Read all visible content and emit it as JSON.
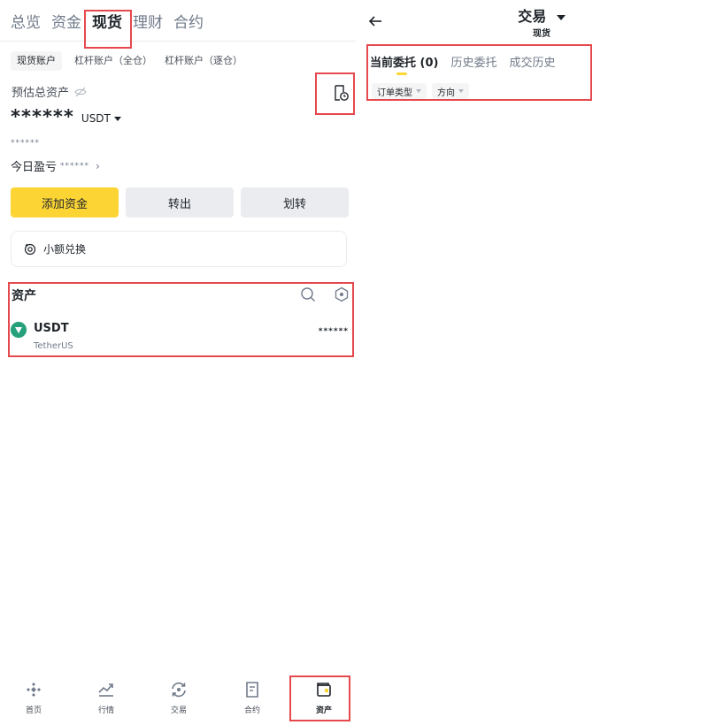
{
  "left": {
    "top_tabs": [
      "总览",
      "资金",
      "现货",
      "理财",
      "合约"
    ],
    "active_top_tab": "现货",
    "sub_tabs": [
      "现货账户",
      "杠杆账户（全仓）",
      "杠杆账户（逐仓）"
    ],
    "est_label": "预估总资产",
    "balance_masked": "******",
    "currency": "USDT",
    "fiat_masked": "******",
    "pnl_label": "今日盈亏",
    "pnl_masked": "******",
    "actions": {
      "add": "添加资金",
      "transfer_out": "转出",
      "transfer": "划转"
    },
    "small_convert": "小额兑换",
    "assets": {
      "title": "资产",
      "rows": [
        {
          "symbol": "USDT",
          "name": "TetherUS",
          "balance": "******"
        }
      ]
    },
    "bottom_nav": [
      "首页",
      "行情",
      "交易",
      "合约",
      "资产"
    ]
  },
  "right": {
    "title": "交易",
    "subtitle": "现货",
    "order_tabs": [
      "当前委托 (0)",
      "历史委托",
      "成交历史"
    ],
    "filters": [
      "订单类型",
      "方向"
    ]
  },
  "colors": {
    "accent": "#fcd535",
    "highlight": "#e5484d",
    "usdt": "#26a17b"
  }
}
